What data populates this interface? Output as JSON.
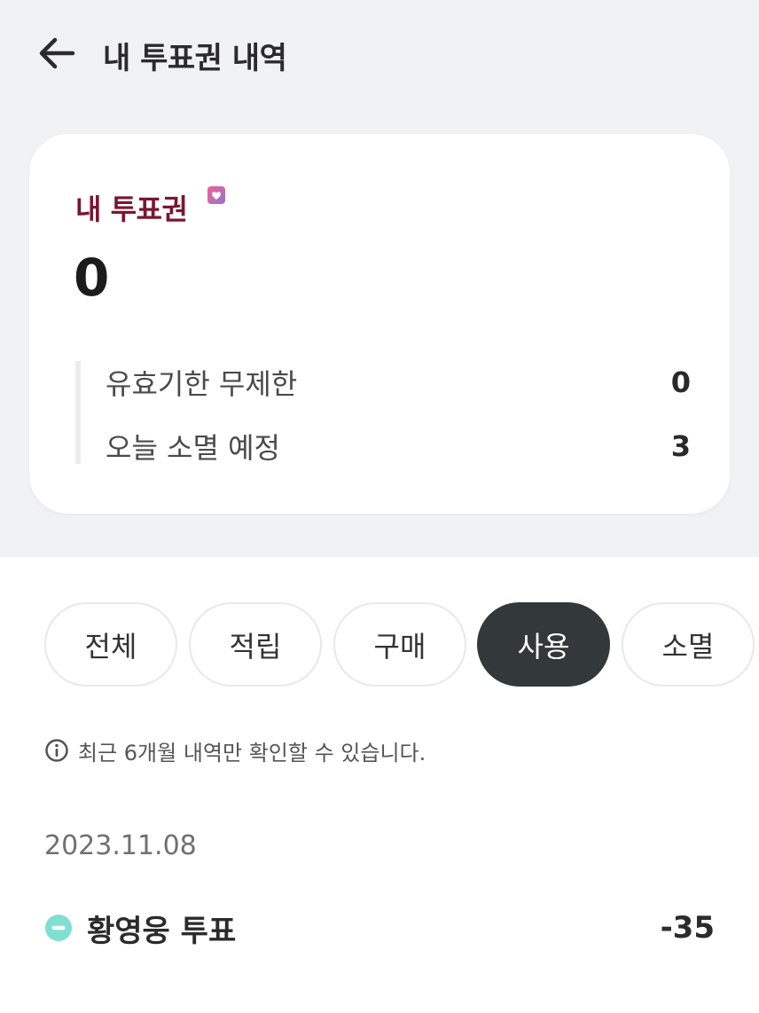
{
  "header": {
    "title": "내 투표권 내역"
  },
  "summary": {
    "title": "내 투표권",
    "total": "0",
    "rows": [
      {
        "label": "유효기한 무제한",
        "value": "0"
      },
      {
        "label": "오늘 소멸 예정",
        "value": "3"
      }
    ]
  },
  "tabs": [
    {
      "label": "전체",
      "active": false
    },
    {
      "label": "적립",
      "active": false
    },
    {
      "label": "구매",
      "active": false
    },
    {
      "label": "사용",
      "active": true
    },
    {
      "label": "소멸",
      "active": false
    }
  ],
  "notice": {
    "text": "최근 6개월 내역만 확인할 수 있습니다."
  },
  "history": [
    {
      "date": "2023.11.08",
      "items": [
        {
          "label": "황영웅 투표",
          "amount": "-35"
        }
      ]
    }
  ],
  "colors": {
    "accent_title": "#7a1631",
    "active_tab": "#33393b",
    "minus_badge": "#7fe0d2",
    "background_top": "#f0f2f4"
  },
  "icons": {
    "back": "arrow-left-icon",
    "ticket": "ticket-heart-icon",
    "info": "info-icon",
    "minus": "minus-circle-icon"
  }
}
